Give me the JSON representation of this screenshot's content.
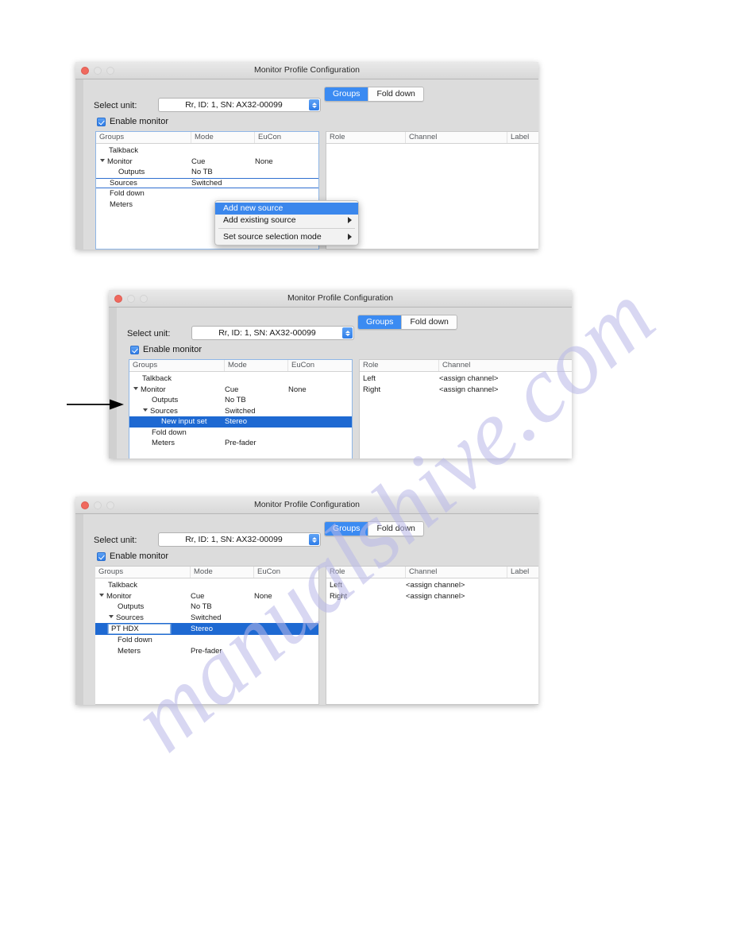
{
  "watermark": {
    "text": "manualshive.com"
  },
  "window": {
    "title": "Monitor Profile Configuration",
    "traffic_lights": [
      "close-button",
      "minimize-button",
      "maximize-button"
    ],
    "tabs": [
      {
        "label": "Groups",
        "active": true
      },
      {
        "label": "Fold down",
        "active": false
      }
    ],
    "select_unit": {
      "label": "Select unit:",
      "value": "Rr, ID: 1, SN: AX32-00099"
    },
    "enable_monitor": {
      "label": "Enable monitor",
      "checked": true
    },
    "groups_columns": [
      "Groups",
      "Mode",
      "EuCon"
    ],
    "roles_columns": [
      "Role",
      "Channel",
      "Label"
    ]
  },
  "panel1": {
    "rows": [
      {
        "name": "Talkback",
        "mode": "",
        "eucon": "",
        "indent": 1,
        "twisty": false,
        "selected": false
      },
      {
        "name": "Monitor",
        "mode": "Cue",
        "eucon": "None",
        "indent": 0,
        "twisty": true,
        "selected": false
      },
      {
        "name": "Outputs",
        "mode": "No TB",
        "eucon": "",
        "indent": 2,
        "twisty": false,
        "selected": false
      },
      {
        "name": "Sources",
        "mode": "Switched",
        "eucon": "",
        "indent": 1,
        "twisty": false,
        "selected": false,
        "focus_ring": true
      },
      {
        "name": "Fold down",
        "mode": "",
        "eucon": "",
        "indent": 1,
        "twisty": false,
        "selected": false
      },
      {
        "name": "Meters",
        "mode": "",
        "eucon": "",
        "indent": 1,
        "twisty": false,
        "selected": false
      }
    ],
    "context_menu": [
      {
        "label": "Add new source",
        "highlighted": true,
        "submenu": false,
        "separator_after": false
      },
      {
        "label": "Add existing source",
        "highlighted": false,
        "submenu": true,
        "separator_after": true
      },
      {
        "label": "Set source selection mode",
        "highlighted": false,
        "submenu": true,
        "separator_after": false
      }
    ],
    "roles": []
  },
  "panel2": {
    "rows": [
      {
        "name": "Talkback",
        "mode": "",
        "eucon": "",
        "indent": 1,
        "twisty": false,
        "selected": false
      },
      {
        "name": "Monitor",
        "mode": "Cue",
        "eucon": "None",
        "indent": 0,
        "twisty": true,
        "selected": false
      },
      {
        "name": "Outputs",
        "mode": "No TB",
        "eucon": "",
        "indent": 2,
        "twisty": false,
        "selected": false
      },
      {
        "name": "Sources",
        "mode": "Switched",
        "eucon": "",
        "indent": 1,
        "twisty": true,
        "selected": false
      },
      {
        "name": "New input set",
        "mode": "Stereo",
        "eucon": "",
        "indent": 3,
        "twisty": false,
        "selected": true
      },
      {
        "name": "Fold down",
        "mode": "",
        "eucon": "",
        "indent": 2,
        "twisty": false,
        "selected": false
      },
      {
        "name": "Meters",
        "mode": "Pre-fader",
        "eucon": "",
        "indent": 2,
        "twisty": false,
        "selected": false
      }
    ],
    "roles": [
      {
        "role": "Left",
        "channel": "<assign channel>",
        "label": ""
      },
      {
        "role": "Right",
        "channel": "<assign channel>",
        "label": ""
      }
    ],
    "roles_columns": [
      "Role",
      "Channel"
    ],
    "annotation": "pointer-arrow"
  },
  "panel3": {
    "rows": [
      {
        "name": "Talkback",
        "mode": "",
        "eucon": "",
        "indent": 1,
        "twisty": false,
        "selected": false
      },
      {
        "name": "Monitor",
        "mode": "Cue",
        "eucon": "None",
        "indent": 0,
        "twisty": true,
        "selected": false
      },
      {
        "name": "Outputs",
        "mode": "No TB",
        "eucon": "",
        "indent": 2,
        "twisty": false,
        "selected": false
      },
      {
        "name": "Sources",
        "mode": "Switched",
        "eucon": "",
        "indent": 1,
        "twisty": true,
        "selected": false
      },
      {
        "name": "PT HDX",
        "mode": "Stereo",
        "eucon": "",
        "indent": 3,
        "twisty": false,
        "selected": true,
        "editing": true
      },
      {
        "name": "Fold down",
        "mode": "",
        "eucon": "",
        "indent": 2,
        "twisty": false,
        "selected": false
      },
      {
        "name": "Meters",
        "mode": "Pre-fader",
        "eucon": "",
        "indent": 2,
        "twisty": false,
        "selected": false
      }
    ],
    "roles": [
      {
        "role": "Left",
        "channel": "<assign channel>",
        "label": ""
      },
      {
        "role": "Right",
        "channel": "<assign channel>",
        "label": ""
      }
    ]
  },
  "colors": {
    "selection_blue": "#1e69d2",
    "tab_active_blue": "#3b8bf2",
    "menu_highlight_blue": "#3b87ec",
    "close_red": "#f0695e",
    "watermark_purple": "#b9b8e8"
  }
}
